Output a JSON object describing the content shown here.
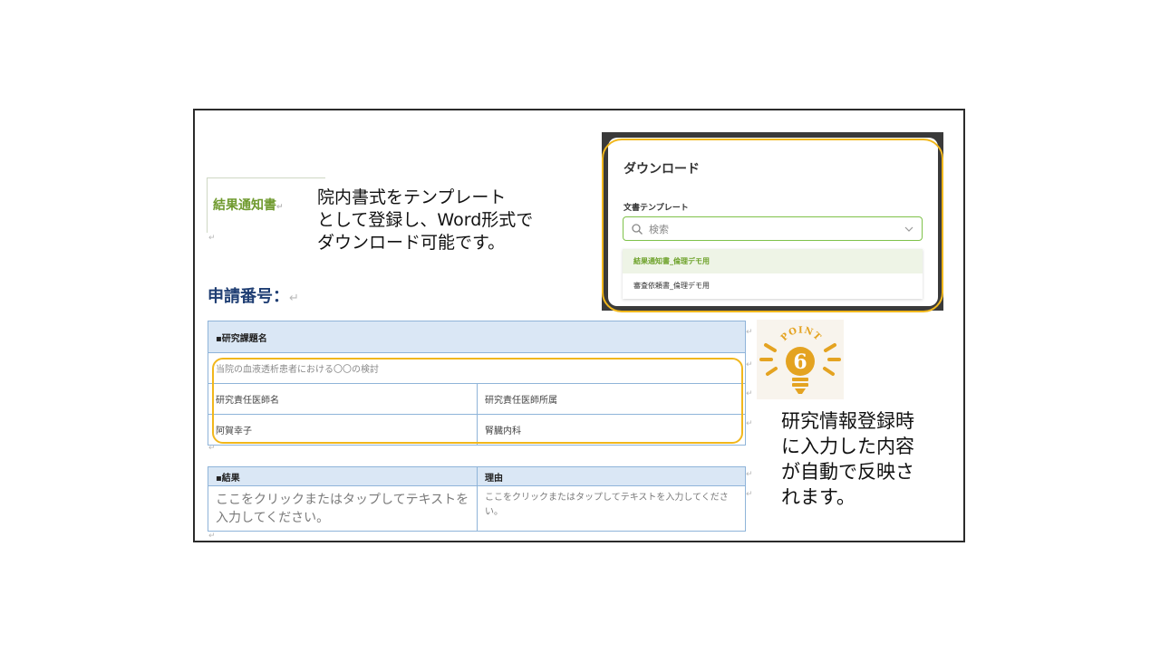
{
  "document": {
    "notice_title": "結果通知書",
    "return_mark": "↵",
    "description": "院内書式をテンプレート\nとして登録し、Word形式で\nダウンロード可能です。",
    "application_number_label": "申請番号：",
    "research_table": {
      "header": "▪研究課題名",
      "title_value": "当院の血液透析患者における〇〇の検討",
      "pi_name_label": "研究責任医師名",
      "pi_dept_label": "研究責任医師所属",
      "pi_name_value": "阿賀幸子",
      "pi_dept_value": "腎臓内科"
    },
    "result_table": {
      "result_header": "▪結果",
      "reason_header": "理由",
      "result_placeholder": "ここをクリックまたはタップしてテキストを入力してください。",
      "reason_placeholder": "ここをクリックまたはタップしてテキストを入力してください。"
    }
  },
  "download_dialog": {
    "title": "ダウンロード",
    "template_label": "文書テンプレート",
    "search_placeholder": "検索",
    "options": [
      "結果通知書_倫理デモ用",
      "審査依頼書_倫理デモ用"
    ],
    "selected_index": 0
  },
  "point_badge": {
    "label": "POINT",
    "number": "6"
  },
  "callout": "研究情報登録時\nに入力した内容\nが自動で反映さ\nれます。",
  "colors": {
    "highlight": "#f1b71c",
    "accent_green": "#6ea22b",
    "table_border": "#8fb4d9",
    "table_header_bg": "#dae7f5",
    "heading_blue": "#1f3e73"
  },
  "icons": [
    "search-icon",
    "chevron-down-icon",
    "lightbulb-icon"
  ]
}
